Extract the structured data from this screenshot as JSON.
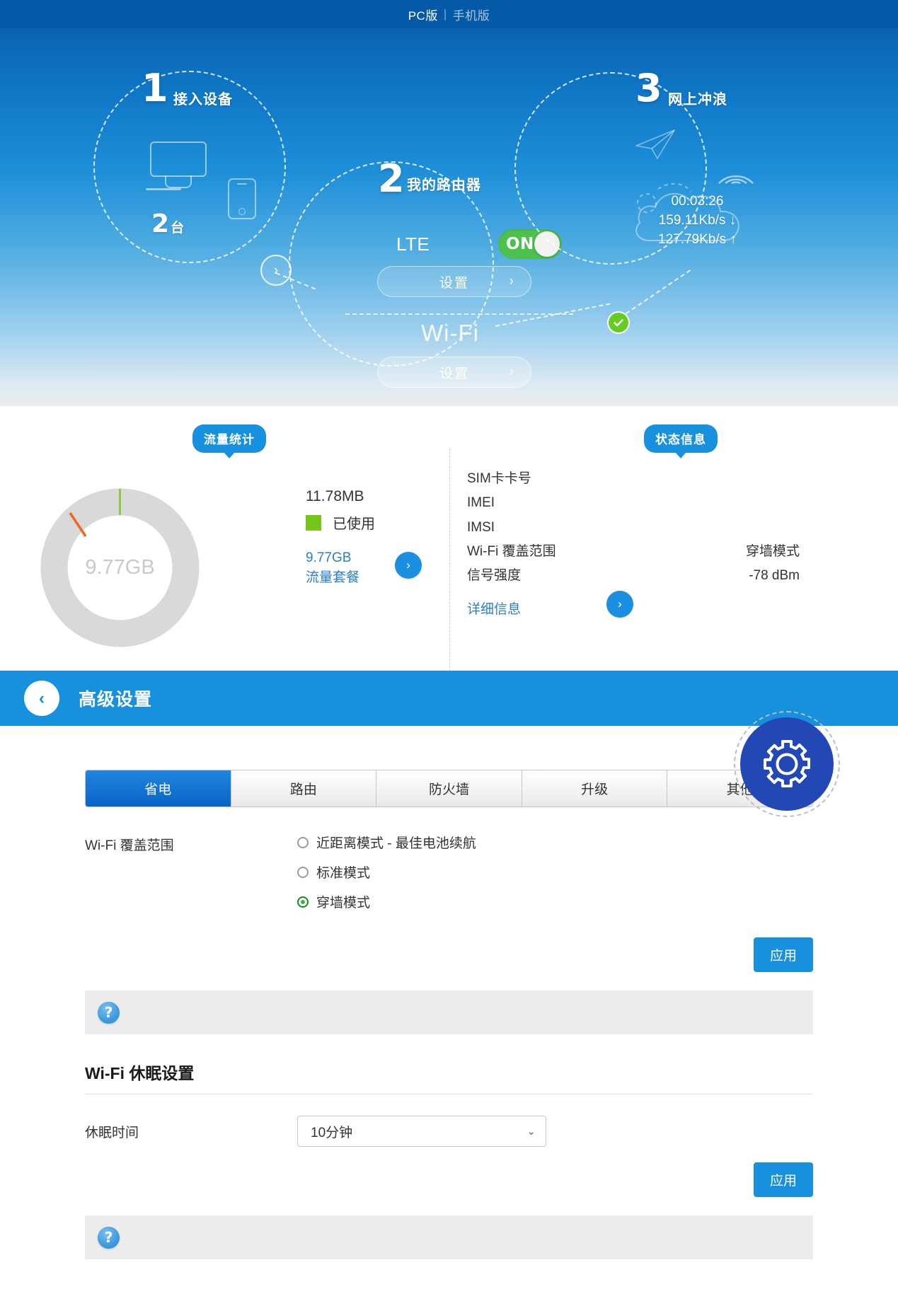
{
  "topbar": {
    "pc_label": "PC版",
    "separator": "|",
    "mobile_label": "手机版"
  },
  "hero": {
    "step1": {
      "number": "1",
      "label": "接入设备",
      "count_number": "2",
      "count_unit": "台",
      "arrow": "›"
    },
    "step2": {
      "number": "2",
      "label": "我的路由器",
      "lte_label": "LTE",
      "lte_toggle_state": "ON",
      "lte_settings_label": "设置",
      "wifi_title": "Wi-Fi",
      "wifi_settings_label": "设置",
      "chevron": "›"
    },
    "step3": {
      "number": "3",
      "label": "网上冲浪",
      "uptime": "00:03:26",
      "download": "159.11Kb/s ↓",
      "upload": "127.79Kb/s ↑",
      "status_check": "✓"
    }
  },
  "stats": {
    "traffic_bubble": "流量统计",
    "status_bubble": "状态信息",
    "donut_center": "9.77GB",
    "used_amount": "11.78MB",
    "used_legend": "已使用",
    "plan_amount": "9.77GB",
    "plan_label": "流量套餐",
    "plan_arrow": "›",
    "detail_arrow": "›",
    "rows": [
      {
        "label": "SIM卡卡号",
        "value": ""
      },
      {
        "label": "IMEI",
        "value": ""
      },
      {
        "label": "IMSI",
        "value": ""
      },
      {
        "label": "Wi-Fi 覆盖范围",
        "value": "穿墙模式"
      },
      {
        "label": "信号强度",
        "value": "-78 dBm"
      }
    ],
    "detail_link": "详细信息"
  },
  "advanced": {
    "back_icon": "‹",
    "title": "高级设置",
    "tabs": [
      {
        "label": "省电",
        "active": true
      },
      {
        "label": "路由",
        "active": false
      },
      {
        "label": "防火墙",
        "active": false
      },
      {
        "label": "升级",
        "active": false
      },
      {
        "label": "其他",
        "active": false
      }
    ],
    "coverage_label": "Wi-Fi 覆盖范围",
    "coverage_options": [
      {
        "label": "近距离模式 - 最佳电池续航",
        "selected": false
      },
      {
        "label": "标准模式",
        "selected": false
      },
      {
        "label": "穿墙模式",
        "selected": true
      }
    ],
    "apply_label": "应用",
    "help_icon": "?",
    "sleep_section_title": "Wi-Fi 休眠设置",
    "sleep_time_label": "休眠时间",
    "sleep_time_value": "10分钟",
    "sleep_chevron": "⌄",
    "apply_label_2": "应用",
    "help_icon_2": "?"
  },
  "colors": {
    "brand_blue": "#1790dd",
    "dark_blue": "#0459a6",
    "tab_active": "#0a63c8",
    "green": "#4cc14e",
    "used_green": "#76c61a",
    "check_green": "#66cc22",
    "gear_blue": "#2347b4"
  }
}
